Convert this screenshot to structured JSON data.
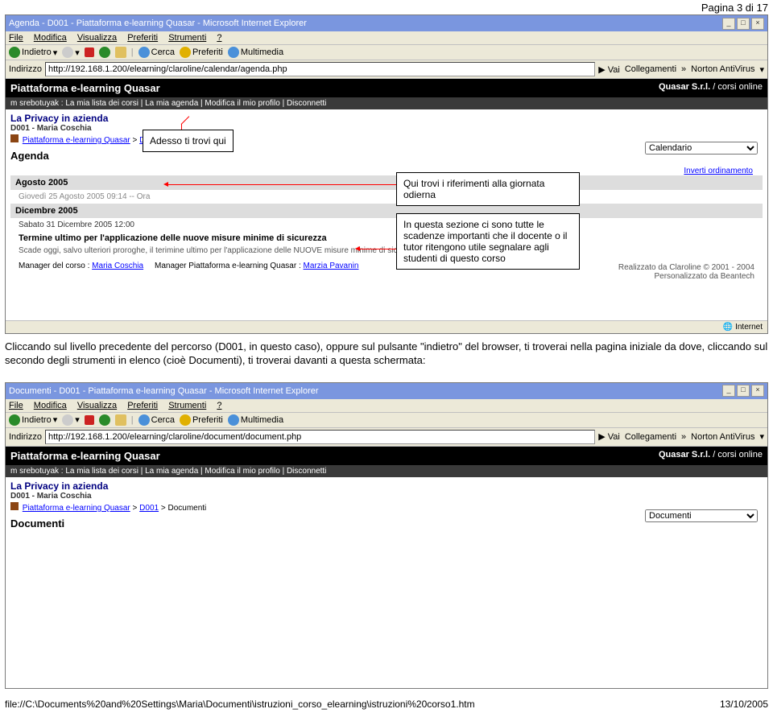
{
  "page_number": "Pagina 3 di 17",
  "window1": {
    "title": "Agenda - D001 - Piattaforma e-learning Quasar - Microsoft Internet Explorer",
    "menu": [
      "File",
      "Modifica",
      "Visualizza",
      "Preferiti",
      "Strumenti",
      "?"
    ],
    "toolbar": {
      "back": "Indietro",
      "search": "Cerca",
      "fav": "Preferiti",
      "media": "Multimedia"
    },
    "address_label": "Indirizzo",
    "address_value": "http://192.168.1.200/elearning/claroline/calendar/agenda.php",
    "go": "Vai",
    "links": "Collegamenti",
    "norton": "Norton AntiVirus",
    "platform_title": "Piattaforma e-learning Quasar",
    "company": "Quasar S.r.l.",
    "company_suffix": "/ corsi online",
    "user_nav": "m srebotuyak : La mia lista dei corsi | La mia agenda | Modifica il mio profilo | Disconnetti",
    "course_title": "La Privacy in azienda",
    "course_code": "D001 - Maria Coschia",
    "breadcrumb_home": "Piattaforma e-learning Quasar",
    "breadcrumb_code": "D001",
    "breadcrumb_current": "Agenda",
    "tool_selected": "Calendario",
    "section_title": "Agenda",
    "invert_link": "Inverti ordinamento",
    "month1": "Agosto 2005",
    "entry1": "Giovedì 25 Agosto 2005 09:14 -- Ora",
    "month2": "Dicembre 2005",
    "entry2": "Sabato 31 Dicembre 2005 12:00",
    "item_title": "Termine ultimo per l'applicazione delle nuove misure minime di sicurezza",
    "item_desc": "Scade oggi, salvo ulteriori proroghe, il terimine ultimo per l'applicazione delle NUOVE misure minime di sicurezza previste dal Codice della privacy.",
    "manager_label": "Manager del corso :",
    "manager_name": "Maria Coschia",
    "manager2_label": "Manager Piattaforma e-learning Quasar :",
    "manager2_name": "Marzia Pavanin",
    "credits_line1": "Realizzato da Claroline © 2001 - 2004",
    "credits_line2": "Personalizzato da Beantech",
    "status_internet": "Internet"
  },
  "callout1": "Adesso ti trovi qui",
  "callout2": "Qui trovi i riferimenti alla giornata odierna",
  "callout3": "In questa sezione ci sono tutte le scadenze importanti che il docente o il tutor ritengono utile segnalare agli studenti di questo corso",
  "paragraph": "Cliccando sul livello precedente del percorso (D001, in questo caso), oppure sul pulsante \"indietro\" del browser, ti troverai nella pagina iniziale da dove, cliccando sul secondo degli strumenti in elenco (cioè Documenti), ti troverai davanti a questa schermata:",
  "window2": {
    "title": "Documenti - D001 - Piattaforma e-learning Quasar - Microsoft Internet Explorer",
    "menu": [
      "File",
      "Modifica",
      "Visualizza",
      "Preferiti",
      "Strumenti",
      "?"
    ],
    "toolbar": {
      "back": "Indietro",
      "search": "Cerca",
      "fav": "Preferiti",
      "media": "Multimedia"
    },
    "address_label": "Indirizzo",
    "address_value": "http://192.168.1.200/elearning/claroline/document/document.php",
    "go": "Vai",
    "links": "Collegamenti",
    "norton": "Norton AntiVirus",
    "platform_title": "Piattaforma e-learning Quasar",
    "company": "Quasar S.r.l.",
    "company_suffix": "/ corsi online",
    "user_nav": "m srebotuyak : La mia lista dei corsi | La mia agenda | Modifica il mio profilo | Disconnetti",
    "course_title": "La Privacy in azienda",
    "course_code": "D001 - Maria Coschia",
    "breadcrumb_home": "Piattaforma e-learning Quasar",
    "breadcrumb_code": "D001",
    "breadcrumb_current": "Documenti",
    "tool_selected": "Documenti",
    "section_title": "Documenti"
  },
  "footer_path": "file://C:\\Documents%20and%20Settings\\Maria\\Documenti\\istruzioni_corso_elearning\\istruzioni%20corso1.htm",
  "footer_date": "13/10/2005"
}
